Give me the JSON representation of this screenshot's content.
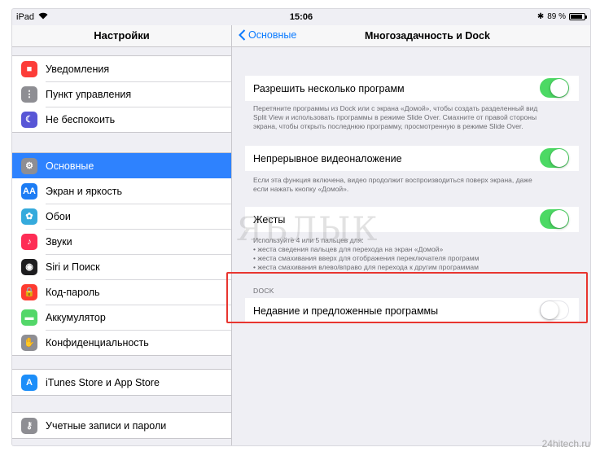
{
  "status_bar": {
    "device": "iPad",
    "time": "15:06",
    "battery_text": "89 %",
    "battery_level": 0.89
  },
  "sidebar": {
    "title": "Настройки",
    "groups": [
      [
        {
          "label": "Уведомления",
          "icon": "notifications-icon",
          "color": "#fc3d39"
        },
        {
          "label": "Пункт управления",
          "icon": "control-center-icon",
          "color": "#8e8e93"
        },
        {
          "label": "Не беспокоить",
          "icon": "moon-icon",
          "color": "#5856d6"
        }
      ],
      [
        {
          "label": "Основные",
          "icon": "gear-icon",
          "color": "#8e8e93",
          "selected": true
        },
        {
          "label": "Экран и яркость",
          "icon": "display-brightness-icon",
          "color": "#1c7cf4"
        },
        {
          "label": "Обои",
          "icon": "wallpaper-icon",
          "color": "#35aadc"
        },
        {
          "label": "Звуки",
          "icon": "sounds-icon",
          "color": "#fe2d55"
        },
        {
          "label": "Siri и Поиск",
          "icon": "siri-icon",
          "color": "#1d1d1f"
        },
        {
          "label": "Код-пароль",
          "icon": "lock-icon",
          "color": "#fe3b30"
        },
        {
          "label": "Аккумулятор",
          "icon": "battery-icon",
          "color": "#53d769"
        },
        {
          "label": "Конфиденциальность",
          "icon": "hand-icon",
          "color": "#8e8e93"
        }
      ],
      [
        {
          "label": "iTunes Store и App Store",
          "icon": "app-store-icon",
          "color": "#1c8ef9"
        }
      ],
      [
        {
          "label": "Учетные записи и пароли",
          "icon": "key-icon",
          "color": "#8e8e93"
        }
      ]
    ]
  },
  "detail": {
    "back_label": "Основные",
    "title": "Многозадачность и Dock",
    "settings": [
      {
        "label": "Разрешить несколько программ",
        "on": true,
        "footer": [
          "Перетяните программы из Dock или с экрана «Домой», чтобы создать разделенный вид",
          "Split View и использовать программы в режиме Slide Over. Смахните от правой стороны",
          "экрана, чтобы открыть последнюю программу, просмотренную в режиме Slide Over."
        ]
      },
      {
        "label": "Непрерывное видеоналожение",
        "on": true,
        "footer": [
          "Если эта функция включена, видео продолжит воспроизводиться поверх экрана, даже",
          "если нажать кнопку «Домой»."
        ]
      },
      {
        "label": "Жесты",
        "on": true,
        "footer": [
          "Используйте 4 или 5 пальцев для:",
          "• жеста сведения пальцев для перехода на экран «Домой»",
          "• жеста смахивания вверх для отображения переключателя программ",
          "• жеста смахивания влево/вправо для перехода к другим программам"
        ]
      }
    ],
    "dock_section": {
      "header": "DOCK",
      "label": "Недавние и предложенные программы",
      "on": false
    }
  },
  "watermark": "ЯБЛЫК",
  "site_watermark": "24hitech.ru",
  "colors": {
    "accent": "#0a7aff",
    "toggle_on": "#4cd964",
    "highlight": "#e8352f",
    "selected": "#2e82fe"
  }
}
